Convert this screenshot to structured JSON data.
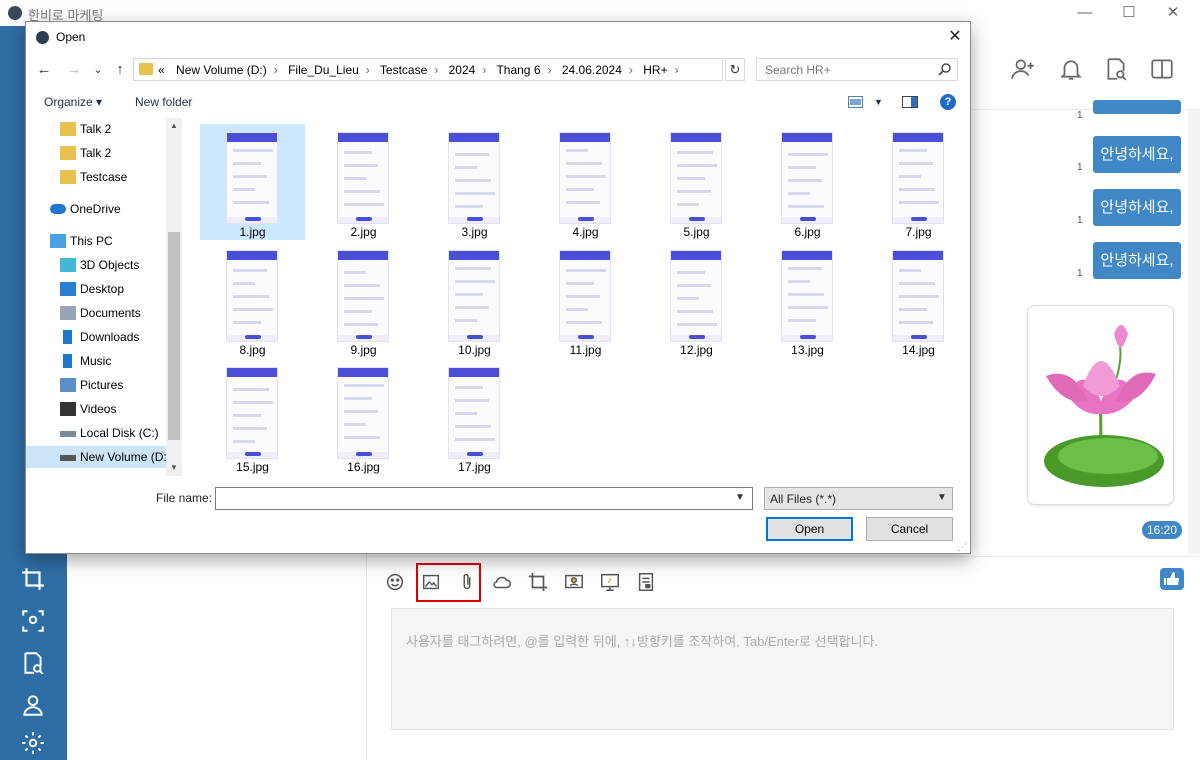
{
  "app": {
    "title": "한비로 마케팅",
    "window_controls": [
      "—",
      "☐",
      "✕"
    ],
    "messages": [
      {
        "text": "안녕하세요,",
        "count": "1"
      },
      {
        "text": "안녕하세요,",
        "count": "1"
      },
      {
        "text": "안녕하세요,",
        "count": "1"
      }
    ],
    "partial_count": "1",
    "time": "16:20",
    "composer_placeholder": "사용자를 태그하려면, @를 입력한 뒤에, ↑↓방향키를 조작하여, Tab/Enter로 선택합니다.",
    "accent_color": "#3f88c5",
    "sidebar_color": "#2f6ea5",
    "highlight_color": "#e00000"
  },
  "dialog": {
    "title": "Open",
    "close": "✕",
    "nav": {
      "back": "←",
      "forward": "→",
      "recent": "⌄",
      "up": "↑"
    },
    "breadcrumb_prefix": "«",
    "breadcrumb": [
      "New Volume (D:)",
      "File_Du_Lieu",
      "Testcase",
      "2024",
      "Thang 6",
      "24.06.2024",
      "HR+"
    ],
    "search_placeholder": "Search HR+",
    "organize": "Organize ▾",
    "new_folder": "New folder",
    "help": "?",
    "nav_items": [
      {
        "label": "Talk 2",
        "icon": "folder-icon"
      },
      {
        "label": "Talk 2",
        "icon": "folder-icon"
      },
      {
        "label": "Testcase",
        "icon": "folder-icon"
      },
      {
        "label": "OneDrive",
        "icon": "cloud-icon"
      },
      {
        "label": "This PC",
        "icon": "pc-icon"
      },
      {
        "label": "3D Objects",
        "icon": "cube-icon"
      },
      {
        "label": "Desktop",
        "icon": "desktop-icon"
      },
      {
        "label": "Documents",
        "icon": "documents-icon"
      },
      {
        "label": "Downloads",
        "icon": "download-icon"
      },
      {
        "label": "Music",
        "icon": "music-icon"
      },
      {
        "label": "Pictures",
        "icon": "pictures-icon"
      },
      {
        "label": "Videos",
        "icon": "videos-icon"
      },
      {
        "label": "Local Disk (C:)",
        "icon": "disk-icon"
      },
      {
        "label": "New Volume (D:",
        "icon": "drive-icon"
      }
    ],
    "files": [
      "1.jpg",
      "2.jpg",
      "3.jpg",
      "4.jpg",
      "5.jpg",
      "6.jpg",
      "7.jpg",
      "8.jpg",
      "9.jpg",
      "10.jpg",
      "11.jpg",
      "12.jpg",
      "13.jpg",
      "14.jpg",
      "15.jpg",
      "16.jpg",
      "17.jpg"
    ],
    "file_name_label": "File name:",
    "file_name_value": "",
    "filter": "All Files (*.*)",
    "open_button": "Open",
    "cancel_button": "Cancel"
  }
}
